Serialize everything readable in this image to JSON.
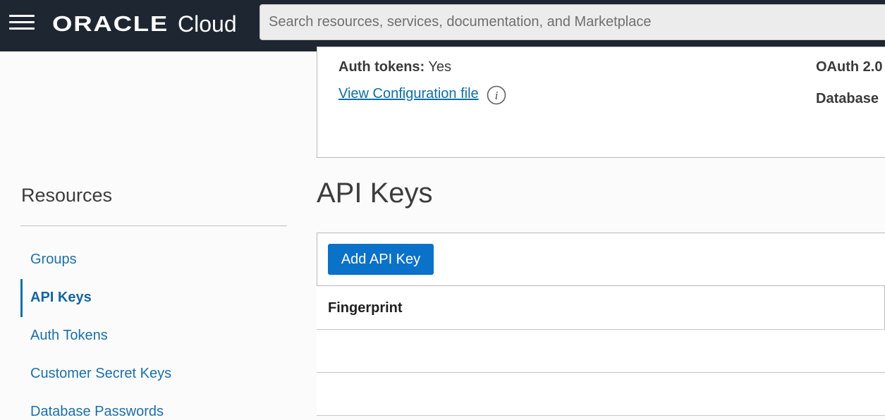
{
  "header": {
    "brand": "ORACLE",
    "product": "Cloud",
    "search_placeholder": "Search resources, services, documentation, and Marketplace"
  },
  "user_details": {
    "auth_tokens_label": "Auth tokens:",
    "auth_tokens_value": "Yes",
    "view_config_link": "View Configuration file",
    "oauth_label": "OAuth 2.0",
    "database_label": "Database"
  },
  "resources": {
    "title": "Resources",
    "items": [
      {
        "label": "Groups",
        "active": false
      },
      {
        "label": "API Keys",
        "active": true
      },
      {
        "label": "Auth Tokens",
        "active": false
      },
      {
        "label": "Customer Secret Keys",
        "active": false
      },
      {
        "label": "Database Passwords",
        "active": false
      }
    ]
  },
  "api_keys": {
    "title": "API Keys",
    "add_button": "Add API Key",
    "columns": [
      "Fingerprint"
    ],
    "rows": [
      [
        ""
      ],
      [
        ""
      ]
    ]
  },
  "colors": {
    "topbar": "#1e2631",
    "link": "#1b6fa6",
    "primary_button": "#0a72c8"
  },
  "icons": {
    "menu": "hamburger-menu-icon",
    "info": "info-icon"
  }
}
